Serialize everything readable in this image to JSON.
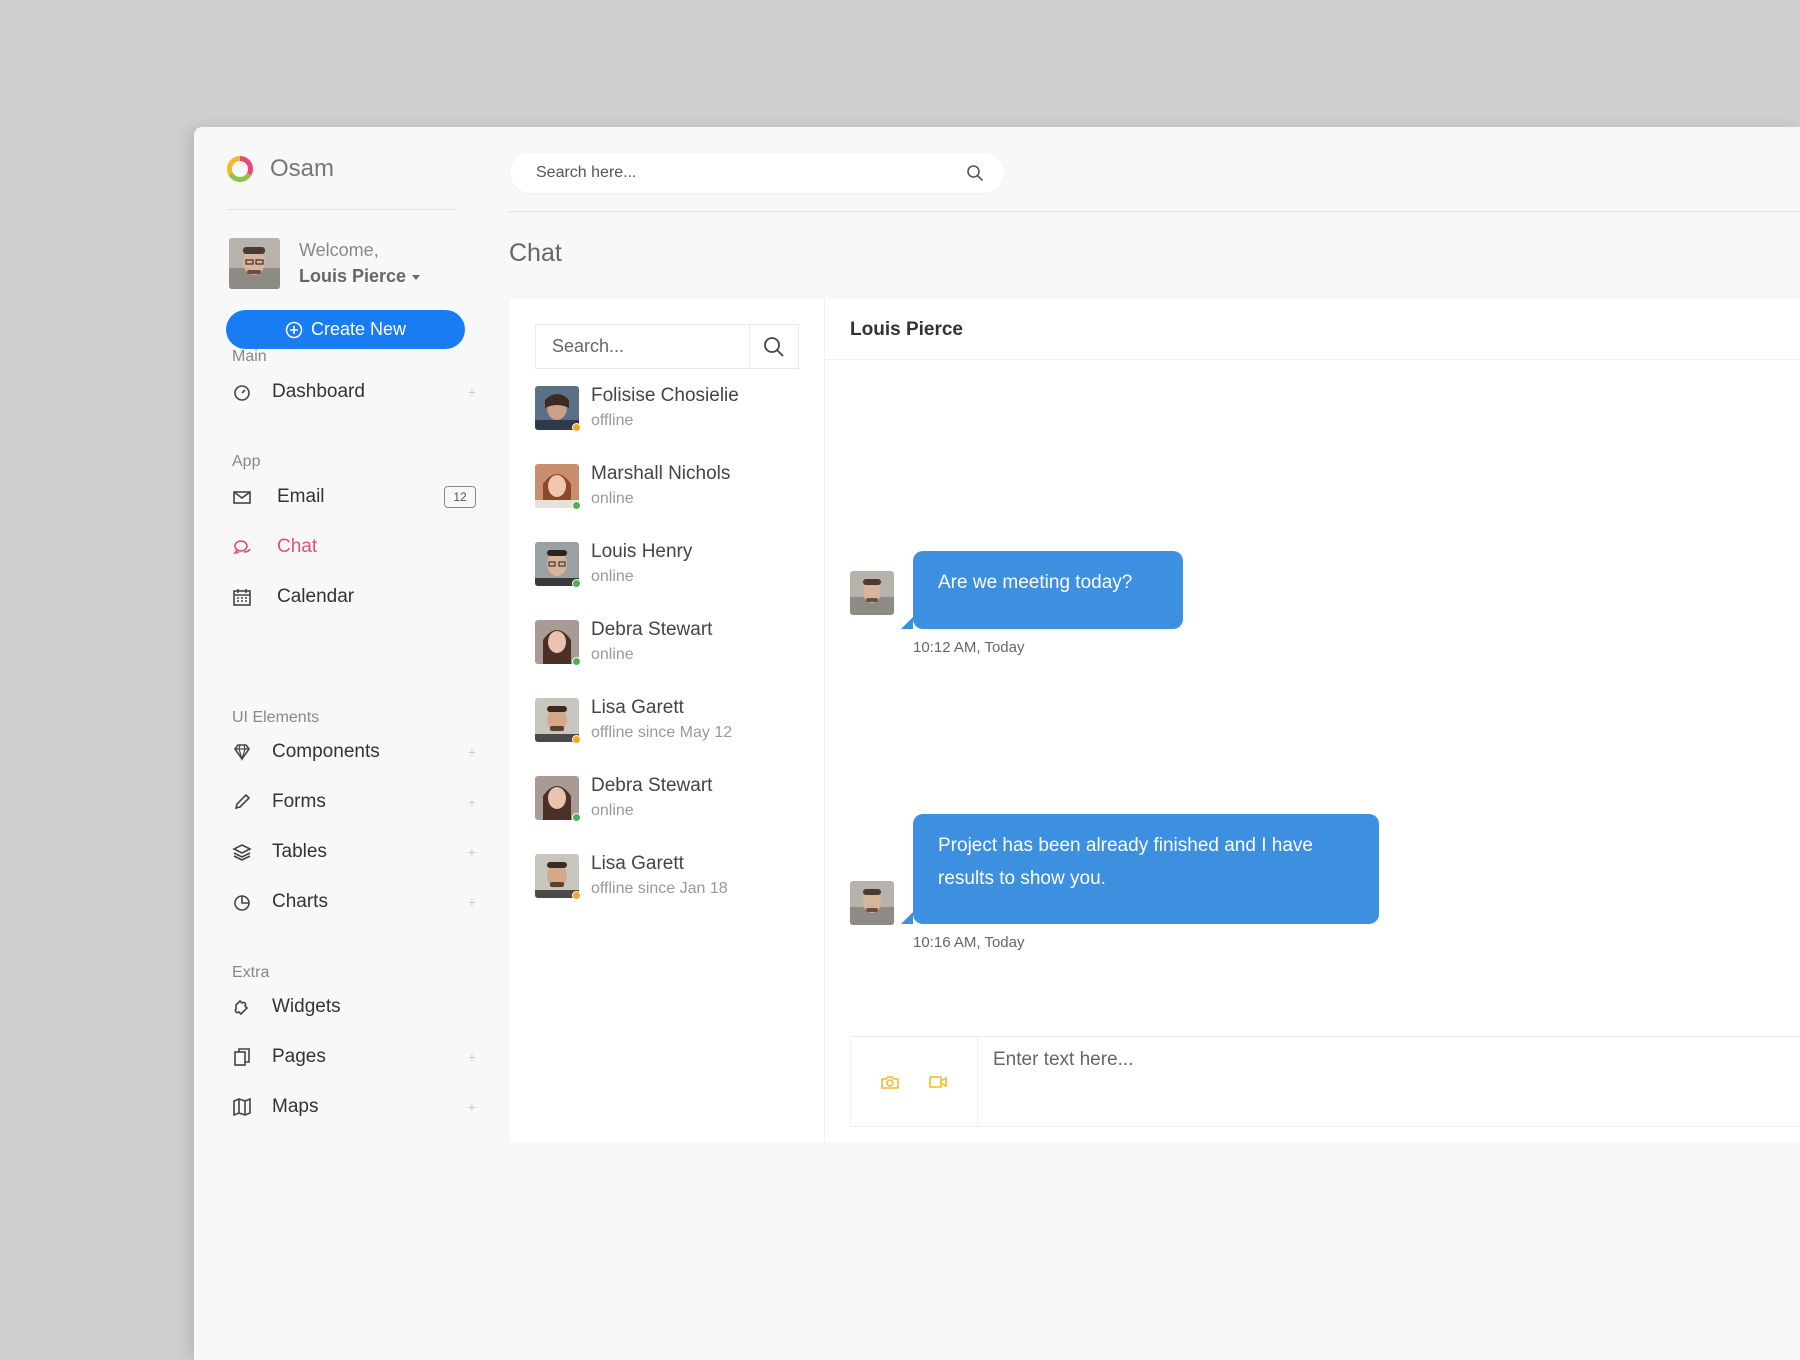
{
  "brand": {
    "name": "Osam"
  },
  "user": {
    "welcome": "Welcome,",
    "name": "Louis Pierce"
  },
  "sidebar": {
    "create_label": "Create New",
    "sections": {
      "main": "Main",
      "app": "App",
      "ui": "UI Elements",
      "extra": "Extra"
    },
    "items": {
      "dashboard": "Dashboard",
      "email": "Email",
      "email_badge": "12",
      "chat": "Chat",
      "calendar": "Calendar",
      "components": "Components",
      "forms": "Forms",
      "tables": "Tables",
      "charts": "Charts",
      "widgets": "Widgets",
      "pages": "Pages",
      "maps": "Maps"
    },
    "expand_symbol": "+"
  },
  "topbar": {
    "search_placeholder": "Search here..."
  },
  "page": {
    "title": "Chat"
  },
  "contacts": {
    "search_placeholder": "Search...",
    "list": [
      {
        "name": "Folisise Chosielie",
        "status": "offline"
      },
      {
        "name": "Marshall Nichols",
        "status": "online"
      },
      {
        "name": "Louis Henry",
        "status": "online"
      },
      {
        "name": "Debra Stewart",
        "status": "online"
      },
      {
        "name": "Lisa Garett",
        "status": "offline since May 12"
      },
      {
        "name": "Debra Stewart",
        "status": "online"
      },
      {
        "name": "Lisa Garett",
        "status": "offline since Jan 18"
      }
    ]
  },
  "conversation": {
    "name": "Louis Pierce",
    "messages": [
      {
        "text": "Are we meeting today?",
        "time": "10:12 AM, Today"
      },
      {
        "text": "Project has been already finished and I have results to show you.",
        "time": "10:16 AM, Today"
      }
    ],
    "composer_placeholder": "Enter text here..."
  },
  "colors": {
    "primary": "#1a7cf2",
    "bubble": "#3d8fe0",
    "active_nav": "#e4506e",
    "online": "#4caf50",
    "offline": "#f5a623",
    "composer_icons": "#f5b92e"
  },
  "icons": {
    "top_search": "search-icon",
    "camera": "camera-icon",
    "video": "video-icon"
  }
}
